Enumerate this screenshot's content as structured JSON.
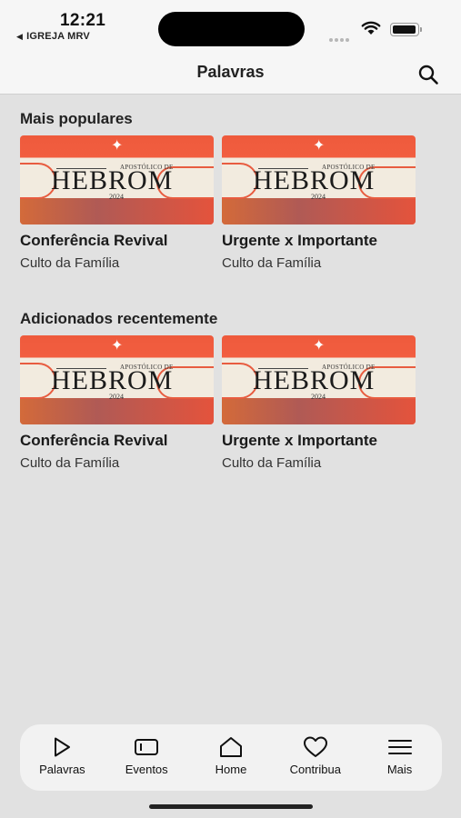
{
  "status_bar": {
    "time": "12:21",
    "back_app": "IGREJA MRV"
  },
  "header": {
    "title": "Palavras"
  },
  "sections": [
    {
      "title": "Mais populares",
      "items": [
        {
          "title": "Conferência Revival",
          "subtitle": "Culto da Família",
          "thumb_word": "HEBROM",
          "thumb_caption": "APOSTÓLICO DE",
          "thumb_year": "2024"
        },
        {
          "title": "Urgente x Importante",
          "subtitle": "Culto da Família",
          "thumb_word": "HEBROM",
          "thumb_caption": "APOSTÓLICO DE",
          "thumb_year": "2024"
        }
      ]
    },
    {
      "title": "Adicionados recentemente",
      "items": [
        {
          "title": "Conferência Revival",
          "subtitle": "Culto da Família",
          "thumb_word": "HEBROM",
          "thumb_caption": "APOSTÓLICO DE",
          "thumb_year": "2024"
        },
        {
          "title": "Urgente x Importante",
          "subtitle": "Culto da Família",
          "thumb_word": "HEBROM",
          "thumb_caption": "APOSTÓLICO DE",
          "thumb_year": "2024"
        }
      ]
    }
  ],
  "tabs": [
    {
      "label": "Palavras",
      "icon": "play-icon"
    },
    {
      "label": "Eventos",
      "icon": "ticket-icon"
    },
    {
      "label": "Home",
      "icon": "home-icon"
    },
    {
      "label": "Contribua",
      "icon": "heart-icon"
    },
    {
      "label": "Mais",
      "icon": "menu-icon"
    }
  ],
  "colors": {
    "background": "#e1e1e1",
    "bar": "#f6f6f6",
    "thumb_accent": "#ee5a3c"
  }
}
